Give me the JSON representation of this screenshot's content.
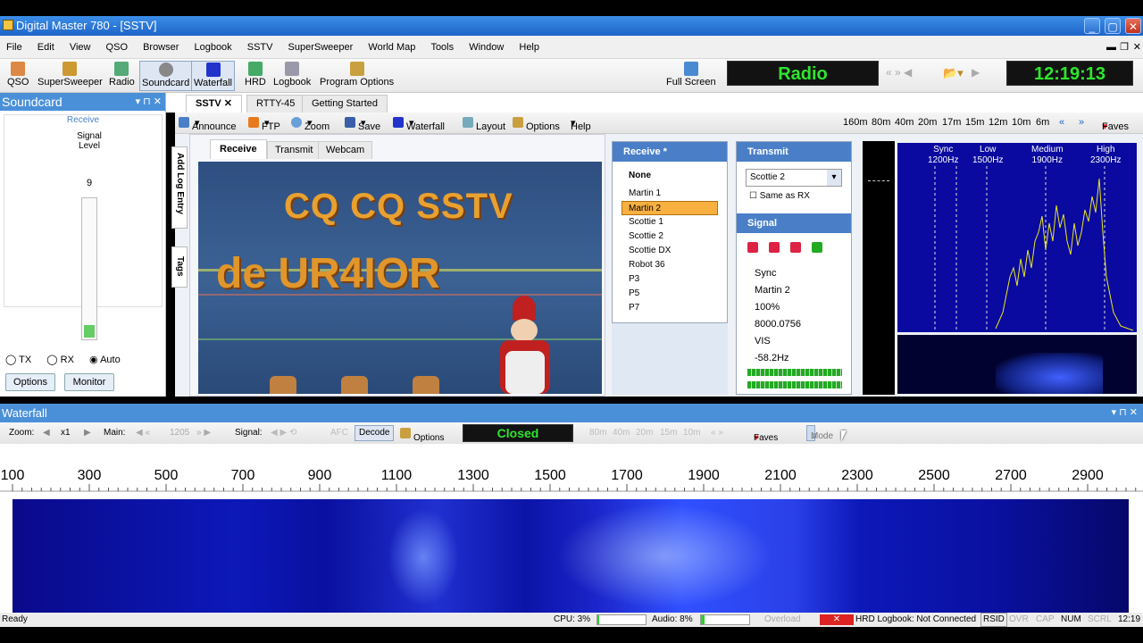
{
  "window": {
    "title": "Digital Master 780 - [SSTV]"
  },
  "menu": [
    "File",
    "Edit",
    "View",
    "QSO",
    "Browser",
    "Logbook",
    "SSTV",
    "SuperSweeper",
    "World Map",
    "Tools",
    "Window",
    "Help"
  ],
  "toolbar": {
    "qso": "QSO",
    "supersweeper": "SuperSweeper",
    "radio": "Radio",
    "soundcard": "Soundcard",
    "waterfall": "Waterfall",
    "hrd": "HRD",
    "logbook": "Logbook",
    "program_options": "Program Options",
    "full_screen": "Full Screen",
    "radio_display": "Radio",
    "clock": "12:19:13"
  },
  "soundcard": {
    "title": "Soundcard",
    "receive": "Receive",
    "signal_level": "Signal Level",
    "value": "9",
    "tx": "TX",
    "rx": "RX",
    "auto": "Auto",
    "options": "Options",
    "monitor": "Monitor"
  },
  "tabs": [
    "SSTV",
    "RTTY-45",
    "Getting Started"
  ],
  "sstv_toolbar": {
    "announce": "Announce",
    "ftp": "FTP",
    "zoom": "Zoom",
    "save": "Save",
    "waterfall": "Waterfall",
    "layout": "Layout",
    "options": "Options",
    "help": "Help",
    "bands": [
      "160m",
      "80m",
      "40m",
      "20m",
      "17m",
      "15m",
      "12m",
      "10m",
      "6m"
    ],
    "faves": "Faves"
  },
  "side_tabs": {
    "add_log": "Add Log Entry",
    "tags": "Tags"
  },
  "image_tabs": [
    "Receive",
    "Transmit",
    "Webcam"
  ],
  "image": {
    "line1": "CQ CQ SSTV",
    "line2": "de UR4IOR"
  },
  "receive": {
    "title": "Receive *",
    "modes": [
      "None",
      "Martin 1",
      "Martin 2",
      "Scottie 1",
      "Scottie 2",
      "Scottie DX",
      "Robot 36",
      "P3",
      "P5",
      "P7"
    ],
    "selected": "Martin 2"
  },
  "transmit": {
    "title": "Transmit",
    "mode": "Scottie 2",
    "same_as_rx": "Same as RX",
    "signal_title": "Signal",
    "signal_values": [
      "Sync",
      "Martin 2",
      "100%",
      "8000.0756",
      "VIS",
      "-58.2Hz"
    ]
  },
  "spectrum": {
    "labels": [
      {
        "name": "Sync",
        "freq": "1200Hz"
      },
      {
        "name": "Low",
        "freq": "1500Hz"
      },
      {
        "name": "Medium",
        "freq": "1900Hz"
      },
      {
        "name": "High",
        "freq": "2300Hz"
      }
    ]
  },
  "waterfall": {
    "title": "Waterfall",
    "zoom_label": "Zoom:",
    "zoom": "x1",
    "main_label": "Main:",
    "main_value": "1205",
    "signal_label": "Signal:",
    "afc": "AFC",
    "decode": "Decode",
    "options": "Options",
    "status": "Closed",
    "bands": [
      "80m",
      "40m",
      "20m",
      "15m",
      "10m"
    ],
    "faves": "Faves",
    "mode": "Mode",
    "scale": [
      "100",
      "300",
      "500",
      "700",
      "900",
      "1100",
      "1300",
      "1500",
      "1700",
      "1900",
      "2100",
      "2300",
      "2500",
      "2700",
      "2900"
    ]
  },
  "statusbar": {
    "ready": "Ready",
    "cpu": "CPU: 3%",
    "audio": "Audio: 8%",
    "overload": "Overload",
    "hrd": "HRD Logbook: Not Connected",
    "rsid": "RSID",
    "ovr": "OVR",
    "cap": "CAP",
    "num": "NUM",
    "scrl": "SCRL",
    "time": "12:19"
  },
  "colors": {
    "title_blue": "#1e64c8",
    "panel_blue": "#4a90d9",
    "lcd_green": "#2ee52e",
    "waterfall_blue": "#0a14c8"
  }
}
